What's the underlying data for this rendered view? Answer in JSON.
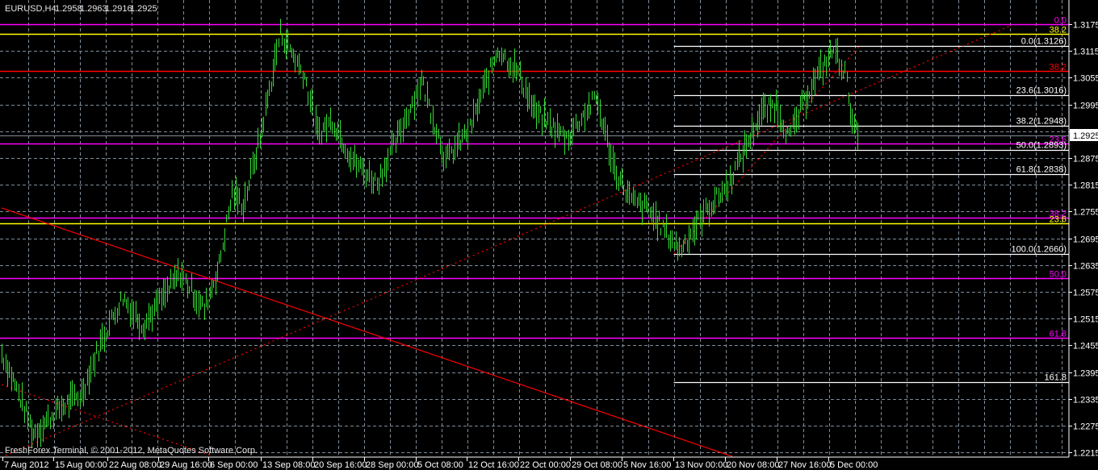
{
  "header": {
    "symbol": "EURUSD,H4",
    "open": "1.2958",
    "high": "1.2963",
    "low": "1.2916",
    "close": "1.2925"
  },
  "copyright": "FreshForex Terminal, © 2001-2012, MetaQuotes Software Corp.",
  "bid_label": "1.2925",
  "colors": {
    "background": "#000000",
    "grid": "#7f8c99",
    "bars": "#33dd33",
    "axis": "#ffffff",
    "trend": "#ff0000",
    "fib": "#ffffff",
    "bid_line": "#808c99"
  },
  "chart_data": {
    "type": "ohlc-bar",
    "symbol": "EURUSD",
    "timeframe": "H4",
    "ylim": [
      1.2185,
      1.3205
    ],
    "price_ticks": [
      "1.3175",
      "1.3115",
      "1.3055",
      "1.2995",
      "1.2935",
      "1.2875",
      "1.2815",
      "1.2755",
      "1.2695",
      "1.2635",
      "1.2575",
      "1.2515",
      "1.2455",
      "1.2395",
      "1.2335",
      "1.2275",
      "1.2215"
    ],
    "time_ticks": [
      "7 Aug 2012",
      "15 Aug 00:00",
      "22 Aug 08:00",
      "29 Aug 16:00",
      "6 Sep 00:00",
      "13 Sep 08:00",
      "20 Sep 16:00",
      "28 Sep 00:00",
      "5 Oct 08:00",
      "12 Oct 16:00",
      "22 Oct 00:00",
      "29 Oct 08:00",
      "5 Nov 16:00",
      "13 Nov 00:00",
      "20 Nov 08:00",
      "27 Nov 16:00",
      "5 Dec 00:00"
    ],
    "price_path": [
      [
        0,
        1.2437
      ],
      [
        9,
        1.2347
      ],
      [
        17,
        1.2257
      ],
      [
        30,
        1.231
      ],
      [
        43,
        1.2347
      ],
      [
        54,
        1.247
      ],
      [
        65,
        1.2563
      ],
      [
        76,
        1.25
      ],
      [
        96,
        1.2617
      ],
      [
        109,
        1.2536
      ],
      [
        117,
        1.2635
      ],
      [
        124,
        1.2797
      ],
      [
        130,
        1.277
      ],
      [
        139,
        1.292
      ],
      [
        150,
        1.3157
      ],
      [
        163,
        1.306
      ],
      [
        170,
        1.293
      ],
      [
        178,
        1.296
      ],
      [
        189,
        1.287
      ],
      [
        202,
        1.282
      ],
      [
        213,
        1.292
      ],
      [
        226,
        1.305
      ],
      [
        239,
        1.287
      ],
      [
        252,
        1.294
      ],
      [
        267,
        1.312
      ],
      [
        278,
        1.3067
      ],
      [
        287,
        1.2977
      ],
      [
        304,
        1.292
      ],
      [
        320,
        1.301
      ],
      [
        330,
        1.285
      ],
      [
        339,
        1.2779
      ],
      [
        348,
        1.276
      ],
      [
        365,
        1.267
      ],
      [
        378,
        1.275
      ],
      [
        391,
        1.2815
      ],
      [
        409,
        1.2977
      ],
      [
        417,
        1.2995
      ],
      [
        424,
        1.292
      ],
      [
        435,
        1.303
      ],
      [
        448,
        1.312
      ],
      [
        454,
        1.3067
      ],
      [
        459,
        1.294
      ],
      [
        461,
        1.2925
      ]
    ],
    "bid": 1.2925,
    "horizontal_levels": [
      {
        "price": 1.3175,
        "label": "0.0",
        "color": "#ff00ff"
      },
      {
        "price": 1.3153,
        "label": "38.2",
        "color": "#ffff00"
      },
      {
        "price": 1.307,
        "label": "38.2",
        "color": "#ff0000"
      },
      {
        "price": 1.2907,
        "label": "23.6",
        "color": "#ff00ff"
      },
      {
        "price": 1.2741,
        "label": "38.2",
        "color": "#ff00ff"
      },
      {
        "price": 1.2728,
        "label": "23.6",
        "color": "#ffff00"
      },
      {
        "price": 1.2605,
        "label": "50.0",
        "color": "#ff00ff"
      },
      {
        "price": 1.2472,
        "label": "61.8",
        "color": "#ff00ff"
      }
    ],
    "fib_levels": [
      {
        "price": 1.3126,
        "label": "0.0(1.3126)"
      },
      {
        "price": 1.3016,
        "label": "23.6(1.3016)"
      },
      {
        "price": 1.2948,
        "label": "38.2(1.2948)"
      },
      {
        "price": 1.2893,
        "label": "50.0(1.2893)"
      },
      {
        "price": 1.2838,
        "label": "61.8(1.2838)"
      },
      {
        "price": 1.266,
        "label": "100.0(1.2660)"
      },
      {
        "price": 1.2372,
        "label": "161.8"
      }
    ],
    "fib_start_bar": 362,
    "trendlines": [
      {
        "from": [
          0,
          1.2763
        ],
        "to": [
          393.5,
          1.2206
        ],
        "style": "solid"
      },
      {
        "from": [
          2,
          1.2208
        ],
        "to": [
          543,
          1.3171
        ],
        "style": "dotted"
      },
      {
        "from": [
          0,
          1.2367
        ],
        "to": [
          113,
          1.2208
        ],
        "style": "dotted"
      },
      {
        "from": [
          362,
          1.266
        ],
        "to": [
          462,
          1.3126
        ],
        "style": "dotted"
      }
    ]
  }
}
